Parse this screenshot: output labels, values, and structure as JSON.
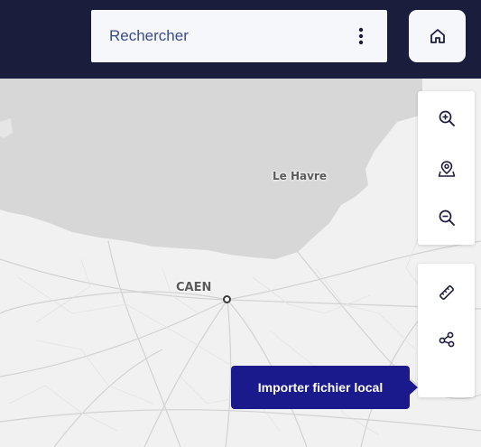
{
  "header": {
    "search_label": "Rechercher",
    "more_icon": "more-vertical-icon",
    "home_icon": "home-icon"
  },
  "map": {
    "places": [
      {
        "name": "Le Havre"
      },
      {
        "name": "CAEN"
      }
    ],
    "colors": {
      "sea": "#d7d7d7",
      "land": "#f1f1f1",
      "roads": "#cfcfcf"
    }
  },
  "toolbar": {
    "zoom_in_icon": "zoom-in-icon",
    "locate_icon": "map-pin-locate-icon",
    "zoom_out_icon": "zoom-out-icon",
    "measure_icon": "ruler-icon",
    "share_icon": "share-icon"
  },
  "tooltip": {
    "text": "Importer fichier local"
  },
  "colors": {
    "header_bg": "#1b1d3c",
    "search_text": "#3a4b8c",
    "tooltip_bg": "#1a1a8c"
  }
}
